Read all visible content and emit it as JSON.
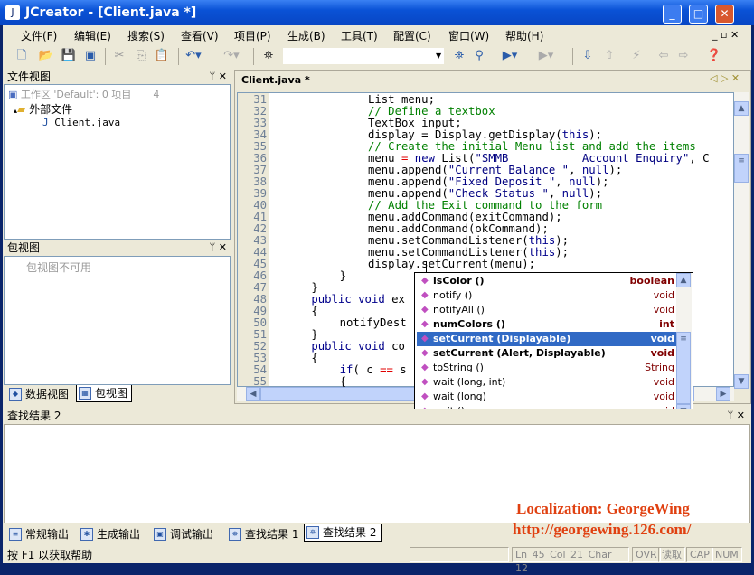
{
  "window": {
    "title": "JCreator - [Client.java *]",
    "app_icon": "jcreator-logo"
  },
  "menu": [
    "文件(F)",
    "编辑(E)",
    "搜索(S)",
    "查看(V)",
    "项目(P)",
    "生成(B)",
    "工具(T)",
    "配置(C)",
    "窗口(W)",
    "帮助(H)"
  ],
  "toolbar": {
    "search_value": ""
  },
  "file_view": {
    "title": "文件视图",
    "workspace": "工作区 'Default': 0 项目",
    "workspace_count": "4",
    "folder": "外部文件",
    "file": "Client.java"
  },
  "package_view": {
    "title": "包视图",
    "message": "包视图不可用"
  },
  "left_tabs": [
    "数据视图",
    "包视图"
  ],
  "editor": {
    "tab": "Client.java *",
    "lines": [
      {
        "n": "31",
        "i": 12,
        "t": [
          [
            "List menu;",
            "id"
          ]
        ]
      },
      {
        "n": "32",
        "i": 12,
        "t": [
          [
            "// Define a textbox",
            "cm"
          ]
        ]
      },
      {
        "n": "33",
        "i": 12,
        "t": [
          [
            "TextBox input;",
            "id"
          ]
        ]
      },
      {
        "n": "34",
        "i": 12,
        "t": [
          [
            "display = Display.getDisplay(",
            "id"
          ],
          [
            "this",
            "kw"
          ],
          [
            ");",
            "id"
          ]
        ]
      },
      {
        "n": "35",
        "i": 12,
        "t": [
          [
            "// Create the initial Menu list and add the items",
            "cm"
          ]
        ]
      },
      {
        "n": "36",
        "i": 12,
        "t": [
          [
            "menu ",
            "id"
          ],
          [
            "=",
            "op"
          ],
          [
            " ",
            "id"
          ],
          [
            "new",
            "kw"
          ],
          [
            " List(",
            "id"
          ],
          [
            "\"SMMB           Account Enquiry\"",
            "st"
          ],
          [
            ", C",
            "id"
          ]
        ]
      },
      {
        "n": "37",
        "i": 12,
        "t": [
          [
            "menu.append(",
            "id"
          ],
          [
            "\"Current Balance \"",
            "st"
          ],
          [
            ", ",
            "id"
          ],
          [
            "null",
            "kw"
          ],
          [
            ");",
            "id"
          ]
        ]
      },
      {
        "n": "38",
        "i": 12,
        "t": [
          [
            "menu.append(",
            "id"
          ],
          [
            "\"Fixed Deposit \"",
            "st"
          ],
          [
            ", ",
            "id"
          ],
          [
            "null",
            "kw"
          ],
          [
            ");",
            "id"
          ]
        ]
      },
      {
        "n": "39",
        "i": 12,
        "t": [
          [
            "menu.append(",
            "id"
          ],
          [
            "\"Check Status \"",
            "st"
          ],
          [
            ", ",
            "id"
          ],
          [
            "null",
            "kw"
          ],
          [
            ");",
            "id"
          ]
        ]
      },
      {
        "n": "40",
        "i": 12,
        "t": [
          [
            "// Add the Exit command to the form",
            "cm"
          ]
        ]
      },
      {
        "n": "41",
        "i": 12,
        "t": [
          [
            "menu.addCommand(exitCommand);",
            "id"
          ]
        ]
      },
      {
        "n": "42",
        "i": 12,
        "t": [
          [
            "menu.addCommand(okCommand);",
            "id"
          ]
        ]
      },
      {
        "n": "43",
        "i": 12,
        "t": [
          [
            "menu.setCommandListener(",
            "id"
          ],
          [
            "this",
            "kw"
          ],
          [
            ");",
            "id"
          ]
        ]
      },
      {
        "n": "44",
        "i": 12,
        "t": [
          [
            "menu.setCommandListener(",
            "id"
          ],
          [
            "this",
            "kw"
          ],
          [
            ");",
            "id"
          ]
        ]
      },
      {
        "n": "45",
        "i": 12,
        "t": [
          [
            "display.setCurrent(menu);",
            "id"
          ]
        ]
      },
      {
        "n": "46",
        "i": 8,
        "t": [
          [
            "}",
            "id"
          ]
        ]
      },
      {
        "n": "47",
        "i": 4,
        "t": [
          [
            "}",
            "id"
          ]
        ]
      },
      {
        "n": "48",
        "i": 4,
        "t": [
          [
            "public void",
            "kw"
          ],
          [
            " ex",
            "id"
          ]
        ]
      },
      {
        "n": "49",
        "i": 4,
        "t": [
          [
            "{",
            "id"
          ]
        ]
      },
      {
        "n": "50",
        "i": 8,
        "t": [
          [
            "notifyDest",
            "id"
          ]
        ]
      },
      {
        "n": "51",
        "i": 4,
        "t": [
          [
            "}",
            "id"
          ]
        ]
      },
      {
        "n": "52",
        "i": 4,
        "t": [
          [
            "public void",
            "kw"
          ],
          [
            " co",
            "id"
          ]
        ]
      },
      {
        "n": "53",
        "i": 4,
        "t": [
          [
            "{",
            "id"
          ]
        ]
      },
      {
        "n": "54",
        "i": 8,
        "t": [
          [
            "if",
            "kw"
          ],
          [
            "( c ",
            "id"
          ],
          [
            "==",
            "op"
          ],
          [
            " s",
            "id"
          ]
        ]
      },
      {
        "n": "55",
        "i": 8,
        "t": [
          [
            "{",
            "id"
          ]
        ]
      }
    ]
  },
  "autocomplete": [
    {
      "name": "isColor ()",
      "ret": "boolean",
      "bold": true
    },
    {
      "name": "notify ()",
      "ret": "void",
      "bold": false
    },
    {
      "name": "notifyAll ()",
      "ret": "void",
      "bold": false
    },
    {
      "name": "numColors ()",
      "ret": "int",
      "bold": true
    },
    {
      "name": "setCurrent (Displayable)",
      "ret": "void",
      "bold": true,
      "selected": true
    },
    {
      "name": "setCurrent (Alert, Displayable)",
      "ret": "void",
      "bold": true
    },
    {
      "name": "toString ()",
      "ret": "String",
      "bold": false
    },
    {
      "name": "wait (long, int)",
      "ret": "void",
      "bold": false
    },
    {
      "name": "wait (long)",
      "ret": "void",
      "bold": false
    },
    {
      "name": "wait ()",
      "ret": "void",
      "bold": false
    }
  ],
  "output": {
    "title": "查找结果 2",
    "watermark1": "Localization: GeorgeWing",
    "watermark2": "http://georgewing.126.com/"
  },
  "bottom_tabs": [
    "常规输出",
    "生成输出",
    "调试输出",
    "查找结果 1",
    "查找结果 2"
  ],
  "status": {
    "help": "按 F1 以获取帮助",
    "ln": "Ln 45",
    "col": "Col 21",
    "char": "Char 12",
    "ovr": "OVR",
    "read": "读取",
    "cap": "CAP",
    "num": "NUM"
  },
  "colors": {
    "title": "#0a52d6",
    "selection": "#316ac5",
    "keyword": "#00008b",
    "comment": "#008000",
    "watermark": "#e04010"
  }
}
